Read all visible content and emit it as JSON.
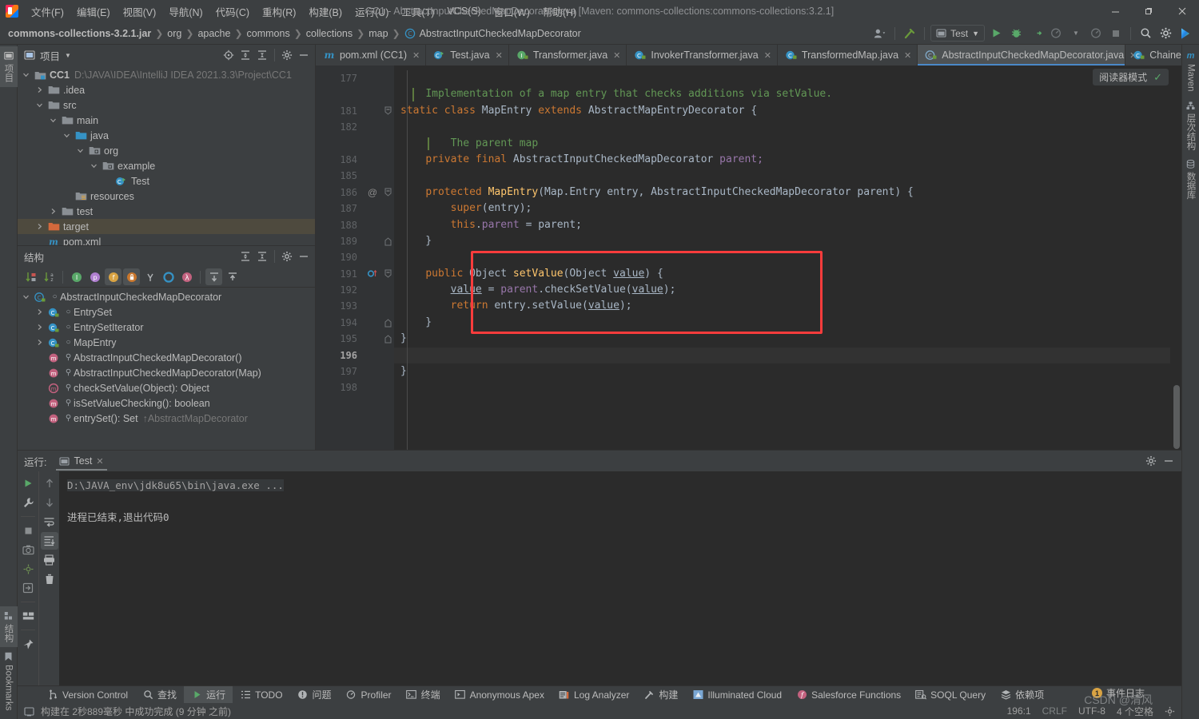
{
  "window": {
    "title": "CC1 - AbstractInputCheckedMapDecorator.java [Maven: commons-collections:commons-collections:3.2.1]",
    "minimize": "—",
    "maximize": "❐",
    "close": "✕"
  },
  "menubar": [
    {
      "label": "文件(F)",
      "name": "menu-file"
    },
    {
      "label": "编辑(E)",
      "name": "menu-edit"
    },
    {
      "label": "视图(V)",
      "name": "menu-view"
    },
    {
      "label": "导航(N)",
      "name": "menu-navigate"
    },
    {
      "label": "代码(C)",
      "name": "menu-code"
    },
    {
      "label": "重构(R)",
      "name": "menu-refactor"
    },
    {
      "label": "构建(B)",
      "name": "menu-build"
    },
    {
      "label": "运行(U)",
      "name": "menu-run"
    },
    {
      "label": "工具(T)",
      "name": "menu-tools"
    },
    {
      "label": "VCS(S)",
      "name": "menu-vcs"
    },
    {
      "label": "窗口(W)",
      "name": "menu-window"
    },
    {
      "label": "帮助(H)",
      "name": "menu-help"
    }
  ],
  "breadcrumb": {
    "items": [
      "commons-collections-3.2.1.jar",
      "org",
      "apache",
      "commons",
      "collections",
      "map",
      "AbstractInputCheckedMapDecorator"
    ],
    "separator": "❯"
  },
  "toolbar": {
    "run_config": "Test",
    "run_tooltip": "运行",
    "debug_tooltip": "调试",
    "search_tooltip": "搜索",
    "settings_tooltip": "设置"
  },
  "sidebar_left": [
    {
      "label": "项目",
      "name": "tool-tab-project",
      "active": true
    },
    {
      "label": "结构",
      "name": "tool-tab-structure",
      "active": true
    },
    {
      "label": "Bookmarks",
      "name": "tool-tab-bookmarks",
      "active": false
    }
  ],
  "sidebar_right": [
    {
      "label": "Maven",
      "name": "tool-tab-maven"
    },
    {
      "label": "层次结构",
      "name": "tool-tab-hierarchy"
    },
    {
      "label": "数据库",
      "name": "tool-tab-database"
    }
  ],
  "project_panel": {
    "title": "项目",
    "tree": [
      {
        "label": "CC1",
        "sub": "D:\\JAVA\\IDEA\\IntelliJ IDEA 2021.3.3\\Project\\CC1",
        "depth": 0,
        "arrow": "v",
        "icon": "module",
        "bold": true,
        "selected": false
      },
      {
        "label": ".idea",
        "sub": "",
        "depth": 1,
        "arrow": ">",
        "icon": "folder",
        "bold": false,
        "selected": false
      },
      {
        "label": "src",
        "sub": "",
        "depth": 1,
        "arrow": "v",
        "icon": "folder",
        "bold": false,
        "selected": false
      },
      {
        "label": "main",
        "sub": "",
        "depth": 2,
        "arrow": "v",
        "icon": "folder",
        "bold": false,
        "selected": false
      },
      {
        "label": "java",
        "sub": "",
        "depth": 3,
        "arrow": "v",
        "icon": "source-root",
        "bold": false,
        "selected": false
      },
      {
        "label": "org",
        "sub": "",
        "depth": 4,
        "arrow": "v",
        "icon": "package",
        "bold": false,
        "selected": false
      },
      {
        "label": "example",
        "sub": "",
        "depth": 5,
        "arrow": "v",
        "icon": "package",
        "bold": false,
        "selected": false
      },
      {
        "label": "Test",
        "sub": "",
        "depth": 6,
        "arrow": "",
        "icon": "java-runnable",
        "bold": false,
        "selected": false
      },
      {
        "label": "resources",
        "sub": "",
        "depth": 3,
        "arrow": "",
        "icon": "resource-root",
        "bold": false,
        "selected": false
      },
      {
        "label": "test",
        "sub": "",
        "depth": 2,
        "arrow": ">",
        "icon": "folder",
        "bold": false,
        "selected": false
      },
      {
        "label": "target",
        "sub": "",
        "depth": 1,
        "arrow": ">",
        "icon": "folder-excluded",
        "bold": false,
        "selected": true
      },
      {
        "label": "pom.xml",
        "sub": "",
        "depth": 1,
        "arrow": "",
        "icon": "maven",
        "bold": false,
        "selected": false
      }
    ]
  },
  "structure_panel": {
    "title": "结构",
    "toolbar_icons": [
      {
        "name": "sort-by-visibility-icon",
        "glyph": "↓"
      },
      {
        "name": "sort-alphabetically-icon",
        "glyph": "↓"
      },
      {
        "name": "show-inherited-icon",
        "glyph": "I"
      },
      {
        "name": "show-properties-icon",
        "glyph": "p"
      },
      {
        "name": "show-fields-icon",
        "glyph": "f"
      },
      {
        "name": "show-non-public-icon",
        "glyph": "🔒"
      },
      {
        "name": "show-anonymous-icon",
        "glyph": "Y"
      },
      {
        "name": "group-by-icon",
        "glyph": "O"
      },
      {
        "name": "show-lambdas-icon",
        "glyph": "λ"
      },
      {
        "name": "expand-all-icon",
        "glyph": "⇞"
      },
      {
        "name": "collapse-all-icon",
        "glyph": "⇟"
      }
    ],
    "tree": [
      {
        "label": "AbstractInputCheckedMapDecorator",
        "depth": 0,
        "arrow": "v",
        "icon": "class",
        "suffix": ""
      },
      {
        "label": "EntrySet",
        "depth": 1,
        "arrow": ">",
        "icon": "inner-class",
        "suffix": ""
      },
      {
        "label": "EntrySetIterator",
        "depth": 1,
        "arrow": ">",
        "icon": "inner-class",
        "suffix": ""
      },
      {
        "label": "MapEntry",
        "depth": 1,
        "arrow": ">",
        "icon": "inner-class",
        "suffix": ""
      },
      {
        "label": "AbstractInputCheckedMapDecorator()",
        "depth": 1,
        "arrow": "",
        "icon": "method",
        "suffix": ""
      },
      {
        "label": "AbstractInputCheckedMapDecorator(Map)",
        "depth": 1,
        "arrow": "",
        "icon": "method",
        "suffix": ""
      },
      {
        "label": "checkSetValue(Object): Object",
        "depth": 1,
        "arrow": "",
        "icon": "abstract-method",
        "suffix": ""
      },
      {
        "label": "isSetValueChecking(): boolean",
        "depth": 1,
        "arrow": "",
        "icon": "method",
        "suffix": ""
      },
      {
        "label": "entrySet(): Set",
        "depth": 1,
        "arrow": "",
        "icon": "method-override",
        "suffix": "↑AbstractMapDecorator"
      }
    ]
  },
  "editor": {
    "tabs": [
      {
        "label": "pom.xml (CC1)",
        "icon": "maven-file",
        "active": false
      },
      {
        "label": "Test.java",
        "icon": "java-runnable",
        "active": false
      },
      {
        "label": "Transformer.java",
        "icon": "interface-locked",
        "active": false
      },
      {
        "label": "InvokerTransformer.java",
        "icon": "class-locked",
        "active": false
      },
      {
        "label": "TransformedMap.java",
        "icon": "class-locked",
        "active": false
      },
      {
        "label": "AbstractInputCheckedMapDecorator.java",
        "icon": "abstract-class-locked",
        "active": true
      },
      {
        "label": "Chained",
        "icon": "class-locked",
        "active": false
      }
    ],
    "tab_overflow": "⌄",
    "tab_more": "⋮",
    "reader_mode_label": "阅读器模式",
    "reader_mode_check": "✓",
    "first_line": 177,
    "current_line": 196,
    "lines": [
      {
        "n": 177,
        "tokens": [],
        "fold": "",
        "anno": ""
      },
      {
        "n": "",
        "tokens": [
          {
            "t": "    ",
            "c": "txt"
          },
          {
            "t": "Implementation of a map entry that checks additions via setValue.",
            "c": "cmt"
          }
        ],
        "fold": "",
        "anno": "",
        "doc": true
      },
      {
        "n": 181,
        "tokens": [
          {
            "t": "static class ",
            "c": "kw"
          },
          {
            "t": "MapEntry ",
            "c": "txt"
          },
          {
            "t": "extends ",
            "c": "kw"
          },
          {
            "t": "AbstractMapEntryDecorator {",
            "c": "txt"
          }
        ],
        "fold": "-",
        "anno": ""
      },
      {
        "n": 182,
        "tokens": [],
        "fold": "",
        "anno": ""
      },
      {
        "n": "",
        "tokens": [
          {
            "t": "        ",
            "c": "txt"
          },
          {
            "t": "The parent map",
            "c": "cmt"
          }
        ],
        "fold": "",
        "anno": "",
        "doc": true,
        "docindent": true
      },
      {
        "n": 184,
        "tokens": [
          {
            "t": "    ",
            "c": "txt"
          },
          {
            "t": "private final ",
            "c": "kw"
          },
          {
            "t": "AbstractInputCheckedMapDecorator ",
            "c": "txt"
          },
          {
            "t": "parent;",
            "c": "fld"
          }
        ],
        "fold": "",
        "anno": ""
      },
      {
        "n": 185,
        "tokens": [],
        "fold": "",
        "anno": ""
      },
      {
        "n": 186,
        "tokens": [
          {
            "t": "    ",
            "c": "txt"
          },
          {
            "t": "protected ",
            "c": "kw"
          },
          {
            "t": "MapEntry",
            "c": "mth"
          },
          {
            "t": "(Map.Entry entry, AbstractInputCheckedMapDecorator parent) {",
            "c": "txt"
          }
        ],
        "fold": "-",
        "anno": "@"
      },
      {
        "n": 187,
        "tokens": [
          {
            "t": "        ",
            "c": "txt"
          },
          {
            "t": "super",
            "c": "kw"
          },
          {
            "t": "(entry);",
            "c": "txt"
          }
        ],
        "fold": "",
        "anno": ""
      },
      {
        "n": 188,
        "tokens": [
          {
            "t": "        ",
            "c": "txt"
          },
          {
            "t": "this",
            "c": "kw"
          },
          {
            "t": ".",
            "c": "txt"
          },
          {
            "t": "parent ",
            "c": "fld"
          },
          {
            "t": "= parent;",
            "c": "txt"
          }
        ],
        "fold": "",
        "anno": ""
      },
      {
        "n": 189,
        "tokens": [
          {
            "t": "    }",
            "c": "txt"
          }
        ],
        "fold": "^",
        "anno": ""
      },
      {
        "n": 190,
        "tokens": [],
        "fold": "",
        "anno": ""
      },
      {
        "n": 191,
        "tokens": [
          {
            "t": "    ",
            "c": "txt"
          },
          {
            "t": "public ",
            "c": "kw"
          },
          {
            "t": "Object ",
            "c": "txt"
          },
          {
            "t": "setValue",
            "c": "mth"
          },
          {
            "t": "(Object ",
            "c": "txt"
          },
          {
            "t": "value",
            "c": "u"
          },
          {
            "t": ") {",
            "c": "txt"
          }
        ],
        "fold": "-",
        "anno": "O↑"
      },
      {
        "n": 192,
        "tokens": [
          {
            "t": "        ",
            "c": "txt"
          },
          {
            "t": "value",
            "c": "u"
          },
          {
            "t": " = ",
            "c": "txt"
          },
          {
            "t": "parent",
            "c": "fld"
          },
          {
            "t": ".",
            "c": "txt"
          },
          {
            "t": "checkSetValue",
            "c": "txt"
          },
          {
            "t": "(",
            "c": "txt"
          },
          {
            "t": "value",
            "c": "u"
          },
          {
            "t": ");",
            "c": "txt"
          }
        ],
        "fold": "",
        "anno": ""
      },
      {
        "n": 193,
        "tokens": [
          {
            "t": "        ",
            "c": "txt"
          },
          {
            "t": "return ",
            "c": "kw"
          },
          {
            "t": "entry.setValue(",
            "c": "txt"
          },
          {
            "t": "value",
            "c": "u"
          },
          {
            "t": ");",
            "c": "txt"
          }
        ],
        "fold": "",
        "anno": ""
      },
      {
        "n": 194,
        "tokens": [
          {
            "t": "    }",
            "c": "txt"
          }
        ],
        "fold": "^",
        "anno": ""
      },
      {
        "n": 195,
        "tokens": [
          {
            "t": "}",
            "c": "txt"
          }
        ],
        "fold": "^",
        "anno": ""
      },
      {
        "n": 196,
        "tokens": [],
        "fold": "",
        "anno": "",
        "current": true
      },
      {
        "n": 197,
        "tokens": [
          {
            "t": "}",
            "c": "txt"
          }
        ],
        "fold": "",
        "anno": ""
      },
      {
        "n": 198,
        "tokens": [],
        "fold": "",
        "anno": ""
      }
    ],
    "highlight_box": {
      "color": "#fa3c3c",
      "label": "setValue-method-highlight"
    }
  },
  "run_panel": {
    "label": "运行:",
    "tab_label": "Test",
    "console_lines": [
      {
        "text": "D:\\JAVA_env\\jdk8u65\\bin\\java.exe ...",
        "style": "dim"
      },
      {
        "text": "",
        "style": "plain"
      },
      {
        "text": "进程已结束,退出代码0",
        "style": "plain"
      }
    ],
    "side_buttons": [
      {
        "name": "rerun-button",
        "glyph": "▶"
      },
      {
        "name": "edit-configuration-button",
        "glyph": "🔧"
      },
      {
        "name": "stop-button",
        "glyph": "■"
      },
      {
        "name": "screenshot-button",
        "glyph": "📷"
      },
      {
        "name": "thread-dump-button",
        "glyph": "✳"
      },
      {
        "name": "export-button",
        "glyph": "⇥"
      },
      {
        "name": "layout-button",
        "glyph": "▤"
      },
      {
        "name": "pin-button",
        "glyph": "📌"
      }
    ],
    "side_buttons2": [
      {
        "name": "up-stacktrace-button",
        "glyph": "↑"
      },
      {
        "name": "down-stacktrace-button",
        "glyph": "↓"
      },
      {
        "name": "soft-wrap-button",
        "glyph": "⏎"
      },
      {
        "name": "scroll-to-end-button",
        "glyph": "⇟",
        "on": true
      },
      {
        "name": "print-button",
        "glyph": "🖨"
      },
      {
        "name": "clear-all-button",
        "glyph": "🗑"
      }
    ]
  },
  "bottom_tools": [
    {
      "label": "Version Control",
      "icon": "branch-icon",
      "name": "bottom-tab-version-control"
    },
    {
      "label": "查找",
      "icon": "search-icon",
      "name": "bottom-tab-find"
    },
    {
      "label": "运行",
      "icon": "run-icon",
      "name": "bottom-tab-run",
      "active": true
    },
    {
      "label": "TODO",
      "icon": "todo-icon",
      "name": "bottom-tab-todo"
    },
    {
      "label": "问题",
      "icon": "problems-icon",
      "name": "bottom-tab-problems"
    },
    {
      "label": "Profiler",
      "icon": "profiler-icon",
      "name": "bottom-tab-profiler"
    },
    {
      "label": "终端",
      "icon": "terminal-icon",
      "name": "bottom-tab-terminal"
    },
    {
      "label": "Anonymous Apex",
      "icon": "apex-icon",
      "name": "bottom-tab-anonymous-apex"
    },
    {
      "label": "Log Analyzer",
      "icon": "log-icon",
      "name": "bottom-tab-log-analyzer"
    },
    {
      "label": "构建",
      "icon": "build-icon",
      "name": "bottom-tab-build"
    },
    {
      "label": "Illuminated Cloud",
      "icon": "cloud-icon",
      "name": "bottom-tab-illuminated-cloud"
    },
    {
      "label": "Salesforce Functions",
      "icon": "salesforce-icon",
      "name": "bottom-tab-salesforce-functions"
    },
    {
      "label": "SOQL Query",
      "icon": "soql-icon",
      "name": "bottom-tab-soql-query"
    },
    {
      "label": "依赖项",
      "icon": "dependencies-icon",
      "name": "bottom-tab-dependencies"
    }
  ],
  "event_log": {
    "count": "1",
    "label": "事件日志"
  },
  "statusbar": {
    "build_status": "构建在 2秒889毫秒 中成功完成 (9 分钟 之前)",
    "caret": "196:1",
    "line_sep": "CRLF",
    "encoding": "UTF-8",
    "indent": "4 个空格",
    "watermark": "CSDN @清风"
  }
}
